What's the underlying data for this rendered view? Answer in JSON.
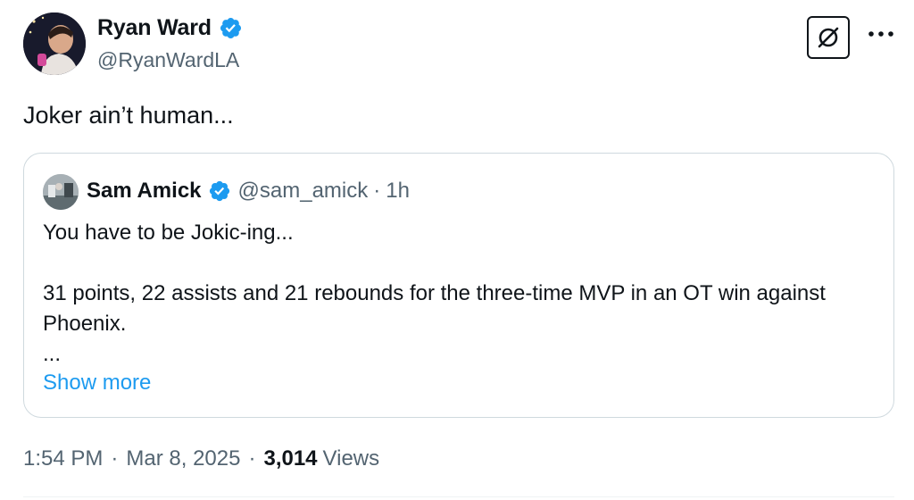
{
  "author": {
    "name": "Ryan Ward",
    "handle": "@RyanWardLA",
    "avatar_icon": "profile-photo",
    "verified_icon": "verified-badge-icon"
  },
  "actions": {
    "grok_icon": "grok-icon",
    "more_icon": "more-dots-icon"
  },
  "tweet": {
    "text": "Joker ain’t human..."
  },
  "quote": {
    "name": "Sam Amick",
    "handle": "@sam_amick",
    "dot": "·",
    "time": "1h",
    "lines": [
      "You have to be Jokic-ing...",
      "31 points, 22 assists and 21 rebounds for the three-time MVP in an OT win against Phoenix.",
      "..."
    ],
    "show_more": "Show more"
  },
  "meta": {
    "time": "1:54 PM",
    "sep": "·",
    "date": "Mar 8, 2025",
    "views_count": "3,014",
    "views_label": "Views"
  },
  "colors": {
    "text": "#0f1419",
    "secondary": "#536471",
    "link": "#1d9bf0",
    "verified": "#1d9bf0",
    "border": "#cfd9de"
  }
}
